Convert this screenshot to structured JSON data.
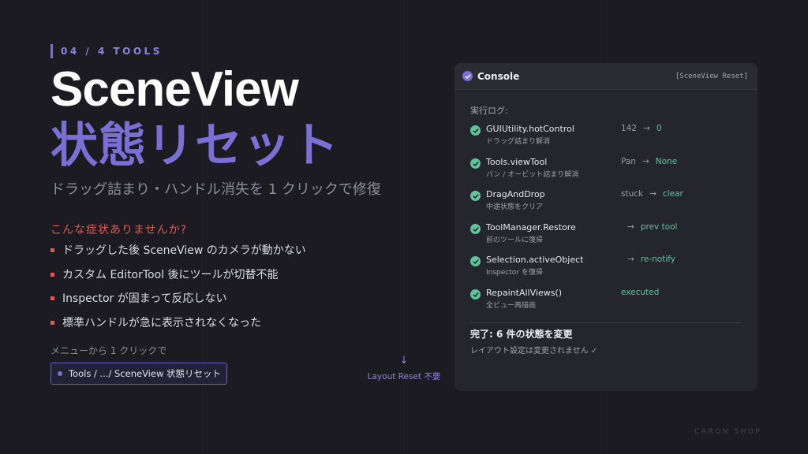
{
  "slide": {
    "tag": "04 / 4 TOOLS"
  },
  "hero": {
    "title_en": "SceneView",
    "title_jp": "状態リセット",
    "subtitle": "ドラッグ詰まり・ハンドル消失を 1 クリックで修復"
  },
  "symptoms": {
    "heading": "こんな症状ありませんか?",
    "items": [
      "ドラッグした後 SceneView のカメラが動かない",
      "カスタム EditorTool 後にツールが切替不能",
      "Inspector が固まって反応しない",
      "標準ハンドルが急に表示されなくなった"
    ]
  },
  "menu": {
    "caption": "メニューから 1 クリックで",
    "path": "Tools / .../ SceneView 状態リセット"
  },
  "layout_note": {
    "arrow": "↓",
    "text": "Layout Reset 不要"
  },
  "console": {
    "title": "Console",
    "tag": "[SceneView Reset]",
    "log_label": "実行ログ:",
    "rows": [
      {
        "api": "GUIUtility.hotControl",
        "desc": "ドラッグ詰まり解消",
        "from": "142",
        "arrow": "→",
        "to": "0"
      },
      {
        "api": "Tools.viewTool",
        "desc": "パン / オービット詰まり解消",
        "from": "Pan",
        "arrow": "→",
        "to": "None"
      },
      {
        "api": "DragAndDrop",
        "desc": "中途状態をクリア",
        "from": "stuck",
        "arrow": "→",
        "to": "clear"
      },
      {
        "api": "ToolManager.Restore",
        "desc": "前のツールに復帰",
        "from": "",
        "arrow": "→",
        "to": "prev tool"
      },
      {
        "api": "Selection.activeObject",
        "desc": "Inspector を復帰",
        "from": "",
        "arrow": "→",
        "to": "re-notify"
      },
      {
        "api": "RepaintAllViews()",
        "desc": "全ビュー再描画",
        "from": "",
        "arrow": "",
        "to": "executed"
      }
    ],
    "done_title": "完了: 6 件の状態を変更",
    "done_note": "レイアウト設定は変更されません ✓"
  },
  "brand": "CARON SHOP",
  "colors": {
    "accent": "#7b6fd6",
    "warning": "#e05a52",
    "success": "#5ec49a",
    "background": "#1b1b21"
  }
}
